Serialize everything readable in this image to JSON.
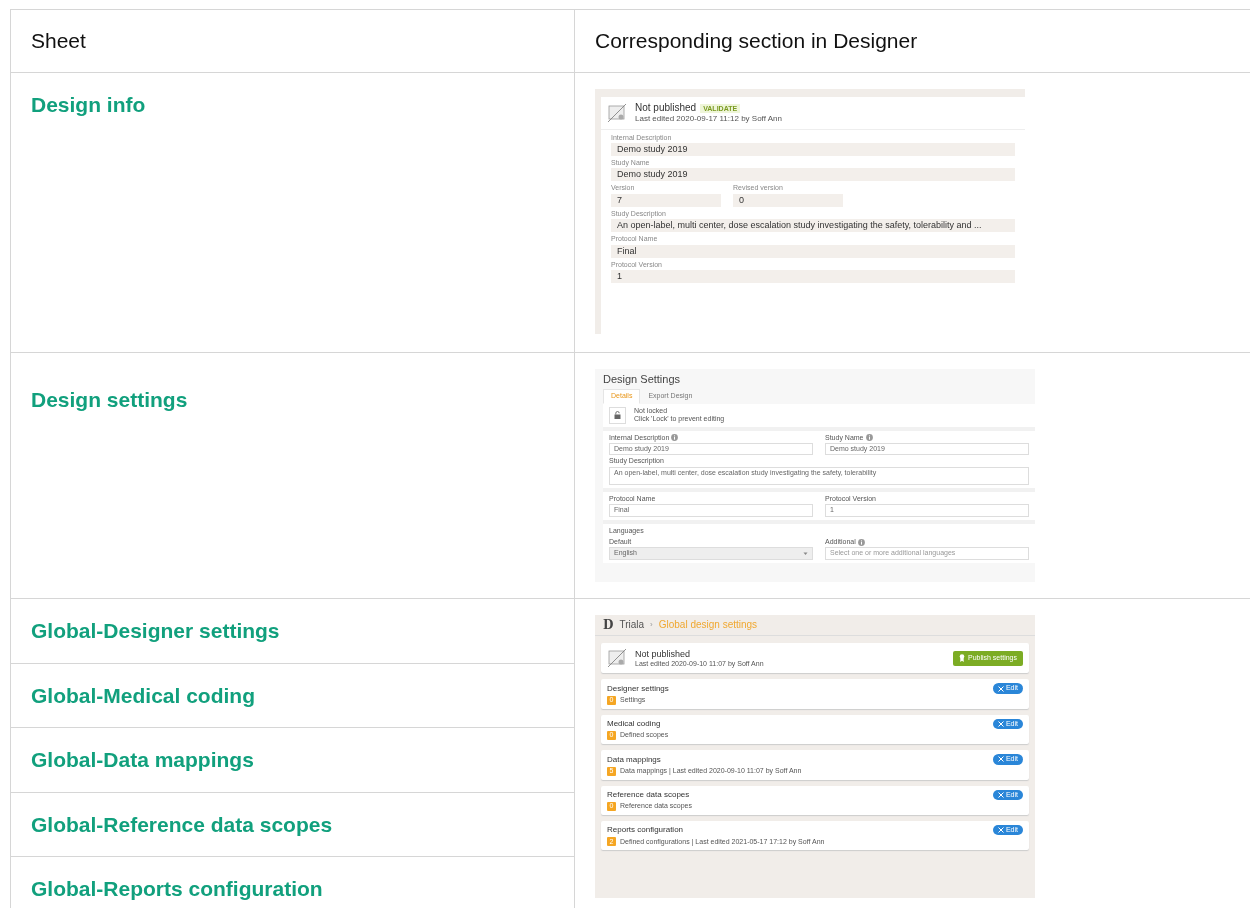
{
  "table": {
    "columns": [
      "Sheet",
      "Corresponding section in Designer"
    ],
    "groups": [
      {
        "sheets": [
          "Design info"
        ],
        "preview": {
          "kind": "info",
          "status": "Not published",
          "badge": "VALIDATE",
          "edited": "Last edited 2020-09-17 11:12 by Soff Ann",
          "field_lines": [
            [
              {
                "label": "Internal Description",
                "value": "Demo study 2019"
              }
            ],
            [
              {
                "label": "Study Name",
                "value": "Demo study 2019"
              }
            ],
            [
              {
                "label": "Version",
                "value": "7"
              },
              {
                "label": "Revised version",
                "value": "0"
              }
            ],
            [
              {
                "label": "Study Description",
                "value": "An open-label, multi center, dose escalation study investigating the safety, tolerability and ..."
              }
            ],
            [
              {
                "label": "Protocol Name",
                "value": "Final"
              }
            ],
            [
              {
                "label": "Protocol Version",
                "value": "1"
              }
            ]
          ]
        }
      },
      {
        "sheets": [
          "Design settings"
        ],
        "preview": {
          "kind": "settings",
          "title": "Design Settings",
          "tabs": [
            {
              "label": "Details",
              "selected": true
            },
            {
              "label": "Export Design",
              "selected": false
            }
          ],
          "lock": {
            "title": "Not locked",
            "hint": "Click 'Lock' to prevent editing"
          },
          "sections": [
            {
              "lines": [
                [
                  {
                    "kind": "input",
                    "label": "Internal Description",
                    "info": true,
                    "value": "Demo study 2019"
                  },
                  {
                    "kind": "input",
                    "label": "Study Name",
                    "info": true,
                    "value": "Demo study 2019"
                  }
                ],
                [
                  {
                    "kind": "textarea",
                    "label": "Study Description",
                    "info": false,
                    "value": "An open-label, multi center, dose escalation study investigating the safety, tolerability"
                  }
                ]
              ]
            },
            {
              "lines": [
                [
                  {
                    "kind": "input",
                    "label": "Protocol Name",
                    "info": false,
                    "value": "Final"
                  },
                  {
                    "kind": "input",
                    "label": "Protocol Version",
                    "info": false,
                    "value": "1"
                  }
                ]
              ]
            },
            {
              "heading": "Languages",
              "lines": [
                [
                  {
                    "kind": "select",
                    "label": "Default",
                    "info": false,
                    "value": "English"
                  },
                  {
                    "kind": "multiselect",
                    "label": "Additional",
                    "info": true,
                    "placeholder": "Select one or more additional languages"
                  }
                ]
              ]
            }
          ]
        }
      },
      {
        "sheets": [
          "Global-Designer settings",
          "Global-Medical coding",
          "Global-Data mappings",
          "Global-Reference data scopes",
          "Global-Reports configuration"
        ],
        "preview": {
          "kind": "global",
          "logo": "D",
          "breadcrumb": [
            "Triala",
            "Global design settings"
          ],
          "separator": "›",
          "status": "Not published",
          "edited": "Last edited 2020-09-10 11:07 by Soff Ann",
          "publish": "Publish settings",
          "sections": [
            {
              "title": "Designer settings",
              "count": "0",
              "text": "Settings",
              "button": "Edit"
            },
            {
              "title": "Medical coding",
              "count": "0",
              "text": "Defined scopes",
              "button": "Edit"
            },
            {
              "title": "Data mappings",
              "count": "5",
              "text": "Data mappings | Last edited 2020-09-10 11:07 by Soff Ann",
              "button": "Edit"
            },
            {
              "title": "Reference data scopes",
              "count": "0",
              "text": "Reference data scopes",
              "button": "Edit"
            },
            {
              "title": "Reports configuration",
              "count": "2",
              "text": "Defined configurations | Last edited 2021-05-17 17:12 by Soff Ann",
              "button": "Edit"
            }
          ]
        }
      }
    ]
  }
}
